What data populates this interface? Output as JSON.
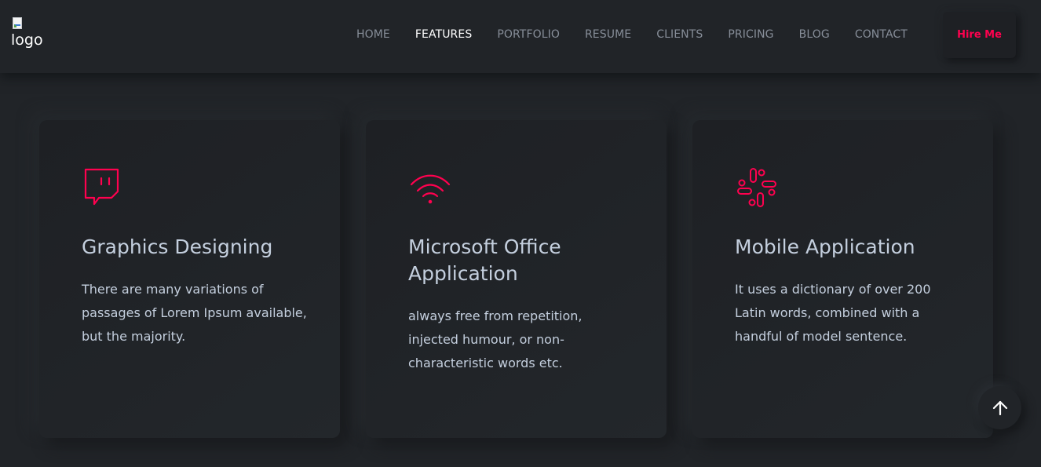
{
  "header": {
    "logo_alt": "logo",
    "nav": [
      {
        "label": "HOME"
      },
      {
        "label": "FEATURES"
      },
      {
        "label": "PORTFOLIO"
      },
      {
        "label": "RESUME"
      },
      {
        "label": "CLIENTS"
      },
      {
        "label": "PRICING"
      },
      {
        "label": "BLOG"
      },
      {
        "label": "CONTACT"
      }
    ],
    "active_nav": "FEATURES",
    "hire_button": "Hire Me"
  },
  "features": [
    {
      "icon": "twitch-icon",
      "title": "Graphics Designing",
      "description": "There are many variations of passages of Lorem Ipsum available, but the majority."
    },
    {
      "icon": "wifi-icon",
      "title": "Microsoft Office Application",
      "description": "always free from repetition, injected humour, or non-characteristic words etc."
    },
    {
      "icon": "slack-icon",
      "title": "Mobile Application",
      "description": "It uses a dictionary of over 200 Latin words, combined with a handful of model sentence."
    }
  ],
  "colors": {
    "background": "#212428",
    "accent": "#ff014f",
    "heading": "#c4cfde",
    "nav": "#878e99"
  },
  "scroll_top_icon": "arrow-up-icon"
}
